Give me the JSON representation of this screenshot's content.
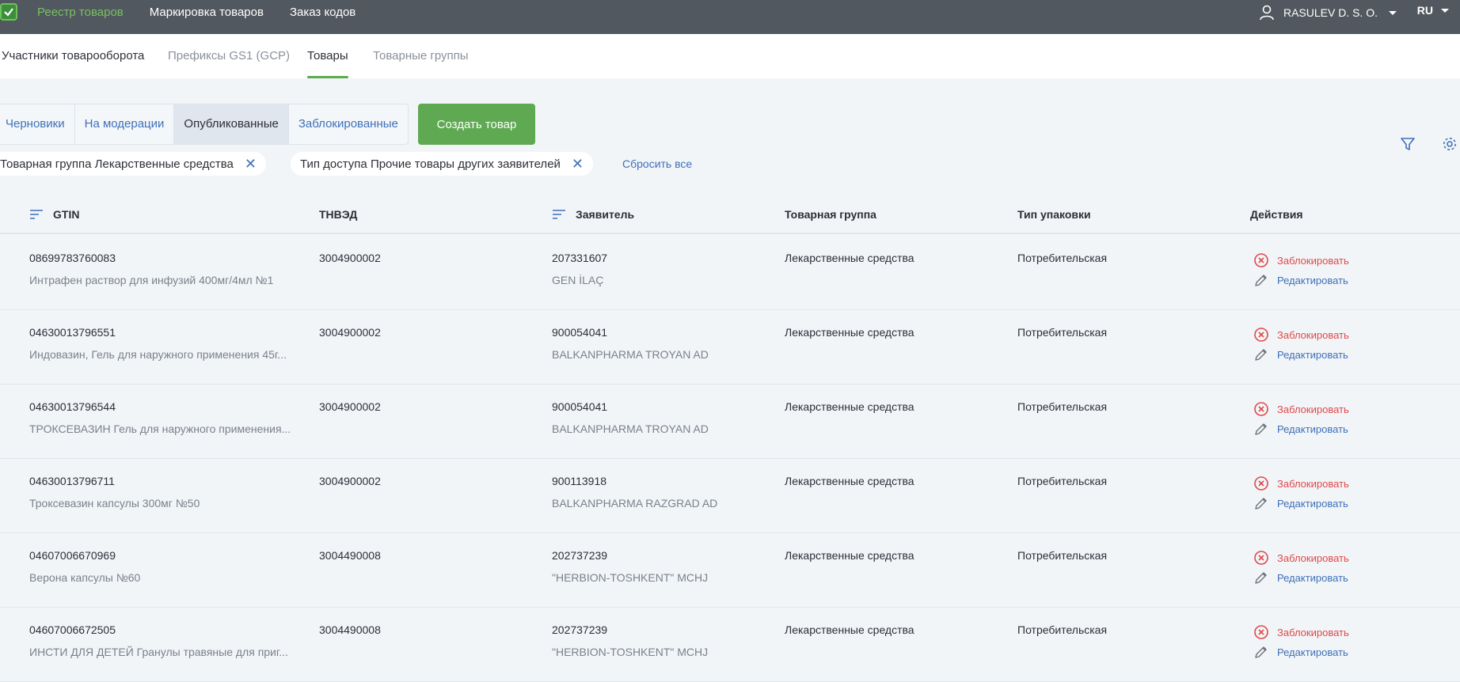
{
  "topnav": {
    "items": [
      "Реестр товаров",
      "Маркировка товаров",
      "Заказ кодов"
    ],
    "user": "RASULEV D. S. O.",
    "lang": "RU"
  },
  "subtabs": [
    "Участники товарооборота",
    "Префиксы GS1 (GCP)",
    "Товары",
    "Товарные группы"
  ],
  "segments": [
    "Черновики",
    "На модерации",
    "Опубликованные",
    "Заблокированные"
  ],
  "create_button": "Создать товар",
  "chips": [
    "Товарная группа Лекарственные средства",
    "Тип доступа Прочие товары других заявителей"
  ],
  "reset_label": "Сбросить все",
  "columns": [
    "GTIN",
    "ТНВЭД",
    "Заявитель",
    "Товарная группа",
    "Тип упаковки",
    "Действия"
  ],
  "actions": {
    "block": "Заблокировать",
    "edit": "Редактировать"
  },
  "rows": [
    {
      "gtin": "08699783760083",
      "name": "Интрафен раствор для инфузий 400мг/4мл №1",
      "tnved": "3004900002",
      "inn": "207331607",
      "applicant": "GEN İLAÇ",
      "group": "Лекарственные средства",
      "pack": "Потребительская"
    },
    {
      "gtin": "04630013796551",
      "name": "Индовазин, Гель для наружного применения 45г...",
      "tnved": "3004900002",
      "inn": "900054041",
      "applicant": "BALKANPHARMA TROYAN AD",
      "group": "Лекарственные средства",
      "pack": "Потребительская"
    },
    {
      "gtin": "04630013796544",
      "name": "ТРОКСЕВАЗИН Гель для наружного применения...",
      "tnved": "3004900002",
      "inn": "900054041",
      "applicant": "BALKANPHARMA TROYAN AD",
      "group": "Лекарственные средства",
      "pack": "Потребительская"
    },
    {
      "gtin": "04630013796711",
      "name": "Троксевазин капсулы 300мг №50",
      "tnved": "3004900002",
      "inn": "900113918",
      "applicant": "BALKANPHARMA RAZGRAD AD",
      "group": "Лекарственные средства",
      "pack": "Потребительская"
    },
    {
      "gtin": "04607006670969",
      "name": "Верона капсулы №60",
      "tnved": "3004490008",
      "inn": "202737239",
      "applicant": "\"HERBION-TOSHKENT\" MCHJ",
      "group": "Лекарственные средства",
      "pack": "Потребительская"
    },
    {
      "gtin": "04607006672505",
      "name": "ИНСТИ ДЛЯ ДЕТЕЙ Гранулы травяные для приг...",
      "tnved": "3004490008",
      "inn": "202737239",
      "applicant": "\"HERBION-TOSHKENT\" MCHJ",
      "group": "Лекарственные средства",
      "pack": "Потребительская"
    }
  ]
}
